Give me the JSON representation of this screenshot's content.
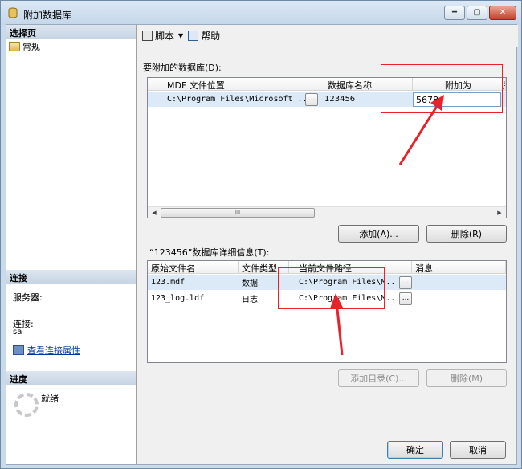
{
  "window": {
    "title": "附加数据库",
    "min_label": "━",
    "max_label": "▢",
    "close_label": "✕"
  },
  "left": {
    "select_page_header": "选择页",
    "nav_general": "常规",
    "connection_header": "连接",
    "server_label": "服务器:",
    "server_value": ".",
    "connection_label": "连接:",
    "connection_value": "sa",
    "view_props_link": "查看连接属性",
    "progress_header": "进度",
    "progress_status": "就绪"
  },
  "toolbar": {
    "script_label": "脚本",
    "help_label": "帮助",
    "dropdown_arrow": "▼"
  },
  "attach_group": {
    "label": "要附加的数据库(D):",
    "columns": [
      "MDF 文件位置",
      "数据库名称",
      "附加为",
      "所"
    ],
    "rows": [
      {
        "mdf": "C:\\Program Files\\Microsoft ...",
        "db_name": "123456",
        "attach_as": "5678"
      }
    ],
    "ellipsis": "...",
    "scroll_thumb_grip": "III",
    "scroll_left": "◀",
    "scroll_right": "▶"
  },
  "buttons": {
    "add": "添加(A)...",
    "remove": "删除(R)",
    "add_catalog": "添加目录(C)...",
    "remove_detail": "删除(M)",
    "ok": "确定",
    "cancel": "取消"
  },
  "detail_group": {
    "label": "“123456”数据库详细信息(T):",
    "columns": [
      "原始文件名",
      "文件类型",
      "当前文件路径",
      "消息"
    ],
    "rows": [
      {
        "file": "123.mdf",
        "type": "数据",
        "path": "C:\\Program Files\\M..."
      },
      {
        "file": "123_log.ldf",
        "type": "日志",
        "path": "C:\\Program Files\\M..."
      }
    ]
  },
  "colors": {
    "annotation_red": "#e8222a",
    "selected_row": "#dceaf7"
  }
}
